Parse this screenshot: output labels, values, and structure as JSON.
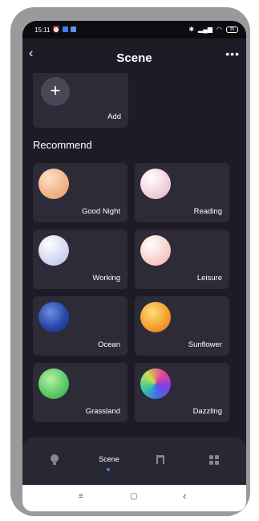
{
  "status_bar": {
    "time": "15:11",
    "battery": "35"
  },
  "header": {
    "title": "Scene",
    "back_icon": "chevron-left-icon",
    "more_icon": "ellipsis-icon"
  },
  "add_card": {
    "label": "Add"
  },
  "recommend": {
    "title": "Recommend",
    "scenes": [
      {
        "label": "Good Night",
        "color": "#f2b58a"
      },
      {
        "label": "Reading",
        "color": "#f1d3dc"
      },
      {
        "label": "Working",
        "color": "#d6daf3"
      },
      {
        "label": "Leisure",
        "color": "#f8d3cf"
      },
      {
        "label": "Ocean",
        "color": "#2a47a8"
      },
      {
        "label": "Sunflower",
        "color": "#f5a12e"
      },
      {
        "label": "Grassland",
        "color": "#5fcb6a"
      },
      {
        "label": "Dazzling",
        "color": "#c04fc9"
      }
    ]
  },
  "bottom_nav": {
    "items": [
      {
        "name": "bulb-icon"
      },
      {
        "label": "Scene"
      },
      {
        "name": "music-icon"
      },
      {
        "name": "grid-icon"
      }
    ]
  },
  "system_nav": {
    "menu": "≡",
    "home": "▢",
    "back": "‹"
  }
}
